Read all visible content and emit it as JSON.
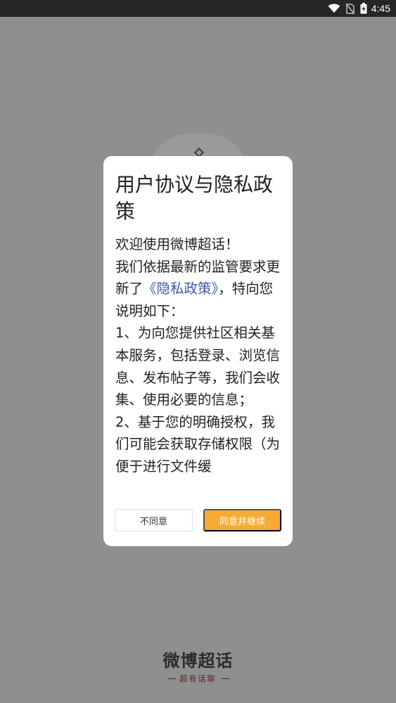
{
  "status_bar": {
    "time": "4:45",
    "icons": [
      "wifi-icon",
      "no-sim-icon",
      "battery-charging-icon"
    ]
  },
  "dialog": {
    "title": "用户协议与隐私政策",
    "body": {
      "greeting": "欢迎使用微博超话！",
      "line1_prefix": "我们依据最新的监管要求更新了",
      "policy_link": "《隐私政策》",
      "line1_suffix": "，特向您说明如下：",
      "item1": "1、为向您提供社区相关基本服务，包括登录、浏览信息、发布帖子等，我们会收集、使用必要的信息；",
      "item2": "2、基于您的明确授权，我们可能会获取存储权限（为便于进行文件缓"
    },
    "decline_label": "不同意",
    "accept_label": "同意并继续"
  },
  "brand": {
    "name": "微博超话",
    "tagline": "超有话聊"
  },
  "colors": {
    "accent": "#f7ab34",
    "link": "#3d5ba9",
    "overlay": "#8f8f8f"
  }
}
